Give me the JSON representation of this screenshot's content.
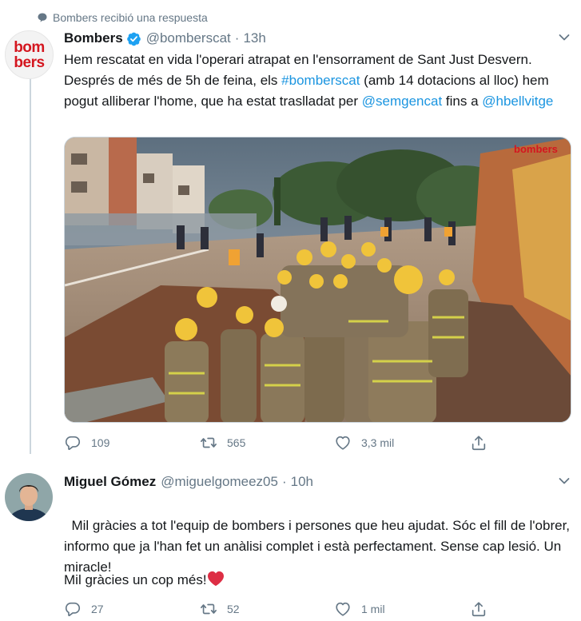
{
  "context": {
    "text": "Bombers recibió una respuesta",
    "icon": "speech-bubble-icon"
  },
  "tweet1": {
    "avatar_text": [
      "bom",
      "bers"
    ],
    "name": "Bombers",
    "handle": "@bomberscat",
    "separator": "·",
    "time": "13h",
    "verified_icon": "verified-badge-icon",
    "text_parts": [
      {
        "t": "Hem rescatat en vida l'operari atrapat en l'ensorrament de Sant Just Desvern. Després de més de 5h de feina, els ",
        "link": false
      },
      {
        "t": "#bomberscat",
        "link": true
      },
      {
        "t": " (amb 14 dotacions al lloc) hem pogut alliberar l'home, que ha estat traslladat per ",
        "link": false
      },
      {
        "t": "@semgencat",
        "link": true
      },
      {
        "t": " fins a ",
        "link": false
      },
      {
        "t": "@hbellvitge",
        "link": true
      }
    ],
    "media_watermark": "bombers",
    "actions": {
      "reply": "109",
      "retweet": "565",
      "like": "3,3 mil",
      "share": ""
    }
  },
  "tweet2": {
    "name": "Miguel Gómez",
    "handle": "@miguelgomeez05",
    "separator": "·",
    "time": "10h",
    "text_main": "Mil gràcies a tot l'equip de bombers i persones que heu ajudat. Sóc el fill de l'obrer, informo que ja l'han fet un anàlisi complet i està perfectament. Sense cap lesió. Un miracle!",
    "text_thanks": "Mil gràcies un cop més!",
    "emoji": "red-heart-emoji",
    "actions": {
      "reply": "27",
      "retweet": "52",
      "like": "1 mil",
      "share": ""
    }
  },
  "colors": {
    "link": "#1b95e0",
    "muted": "#657786",
    "brand_red": "#d4161f",
    "heart": "#e0245e"
  }
}
